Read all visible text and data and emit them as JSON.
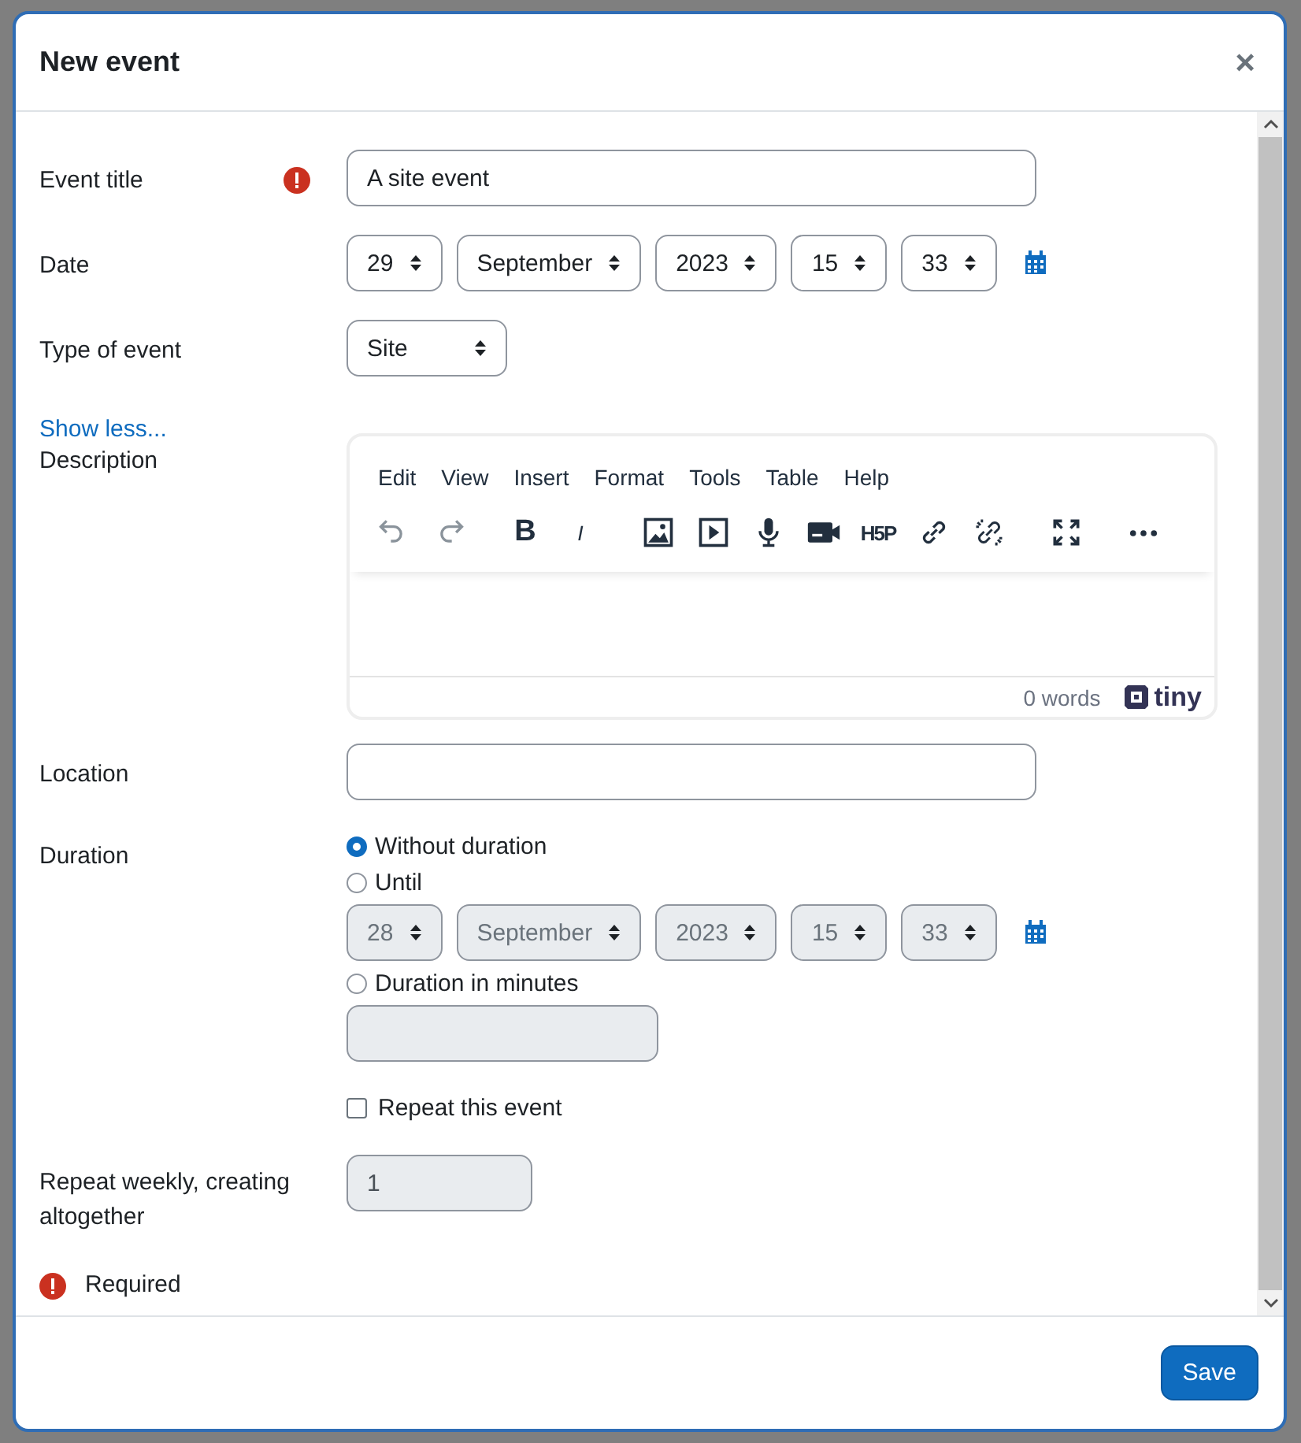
{
  "dialog": {
    "title": "New event",
    "close": "×"
  },
  "fields": [
    {
      "kind": "text",
      "label": "Event title",
      "required": true,
      "value": "A site event"
    },
    {
      "kind": "datetime",
      "label": "Date",
      "selects": [
        "29",
        "September",
        "2023",
        "15",
        "33"
      ],
      "disabled": false
    },
    {
      "kind": "select",
      "label": "Type of event",
      "value": "Site"
    },
    {
      "kind": "link",
      "text": "Show less..."
    },
    {
      "kind": "editor",
      "label": "Description",
      "menu": [
        "Edit",
        "View",
        "Insert",
        "Format",
        "Tools",
        "Table",
        "Help"
      ],
      "toolbar": [
        {
          "kind": "undo",
          "disabled": true
        },
        {
          "kind": "redo",
          "disabled": true
        },
        {
          "kind": "bold",
          "text": "B"
        },
        {
          "kind": "italic",
          "text": "I"
        },
        {
          "kind": "image"
        },
        {
          "kind": "media"
        },
        {
          "kind": "audio"
        },
        {
          "kind": "video"
        },
        {
          "kind": "h5p",
          "text": "H5P"
        },
        {
          "kind": "link"
        },
        {
          "kind": "unlink"
        },
        {
          "kind": "fullscreen"
        },
        {
          "kind": "more"
        }
      ],
      "word_count": "0 words",
      "brand": "tiny"
    },
    {
      "kind": "text",
      "label": "Location"
    },
    {
      "kind": "duration",
      "label": "Duration",
      "options": [
        {
          "label": "Without duration",
          "selected": true
        },
        {
          "label": "Until",
          "selected": false
        },
        {
          "label": "Duration in minutes",
          "selected": false
        }
      ],
      "until": {
        "selects": [
          "28",
          "September",
          "2023",
          "15",
          "33"
        ],
        "disabled": true
      },
      "minutes": {
        "disabled": true
      },
      "repeat": {
        "label": "Repeat this event",
        "checked": false
      }
    },
    {
      "kind": "number",
      "label": "Repeat weekly, creating altogether",
      "value": "1",
      "disabled": true
    }
  ],
  "required_note": "Required",
  "save": "Save"
}
